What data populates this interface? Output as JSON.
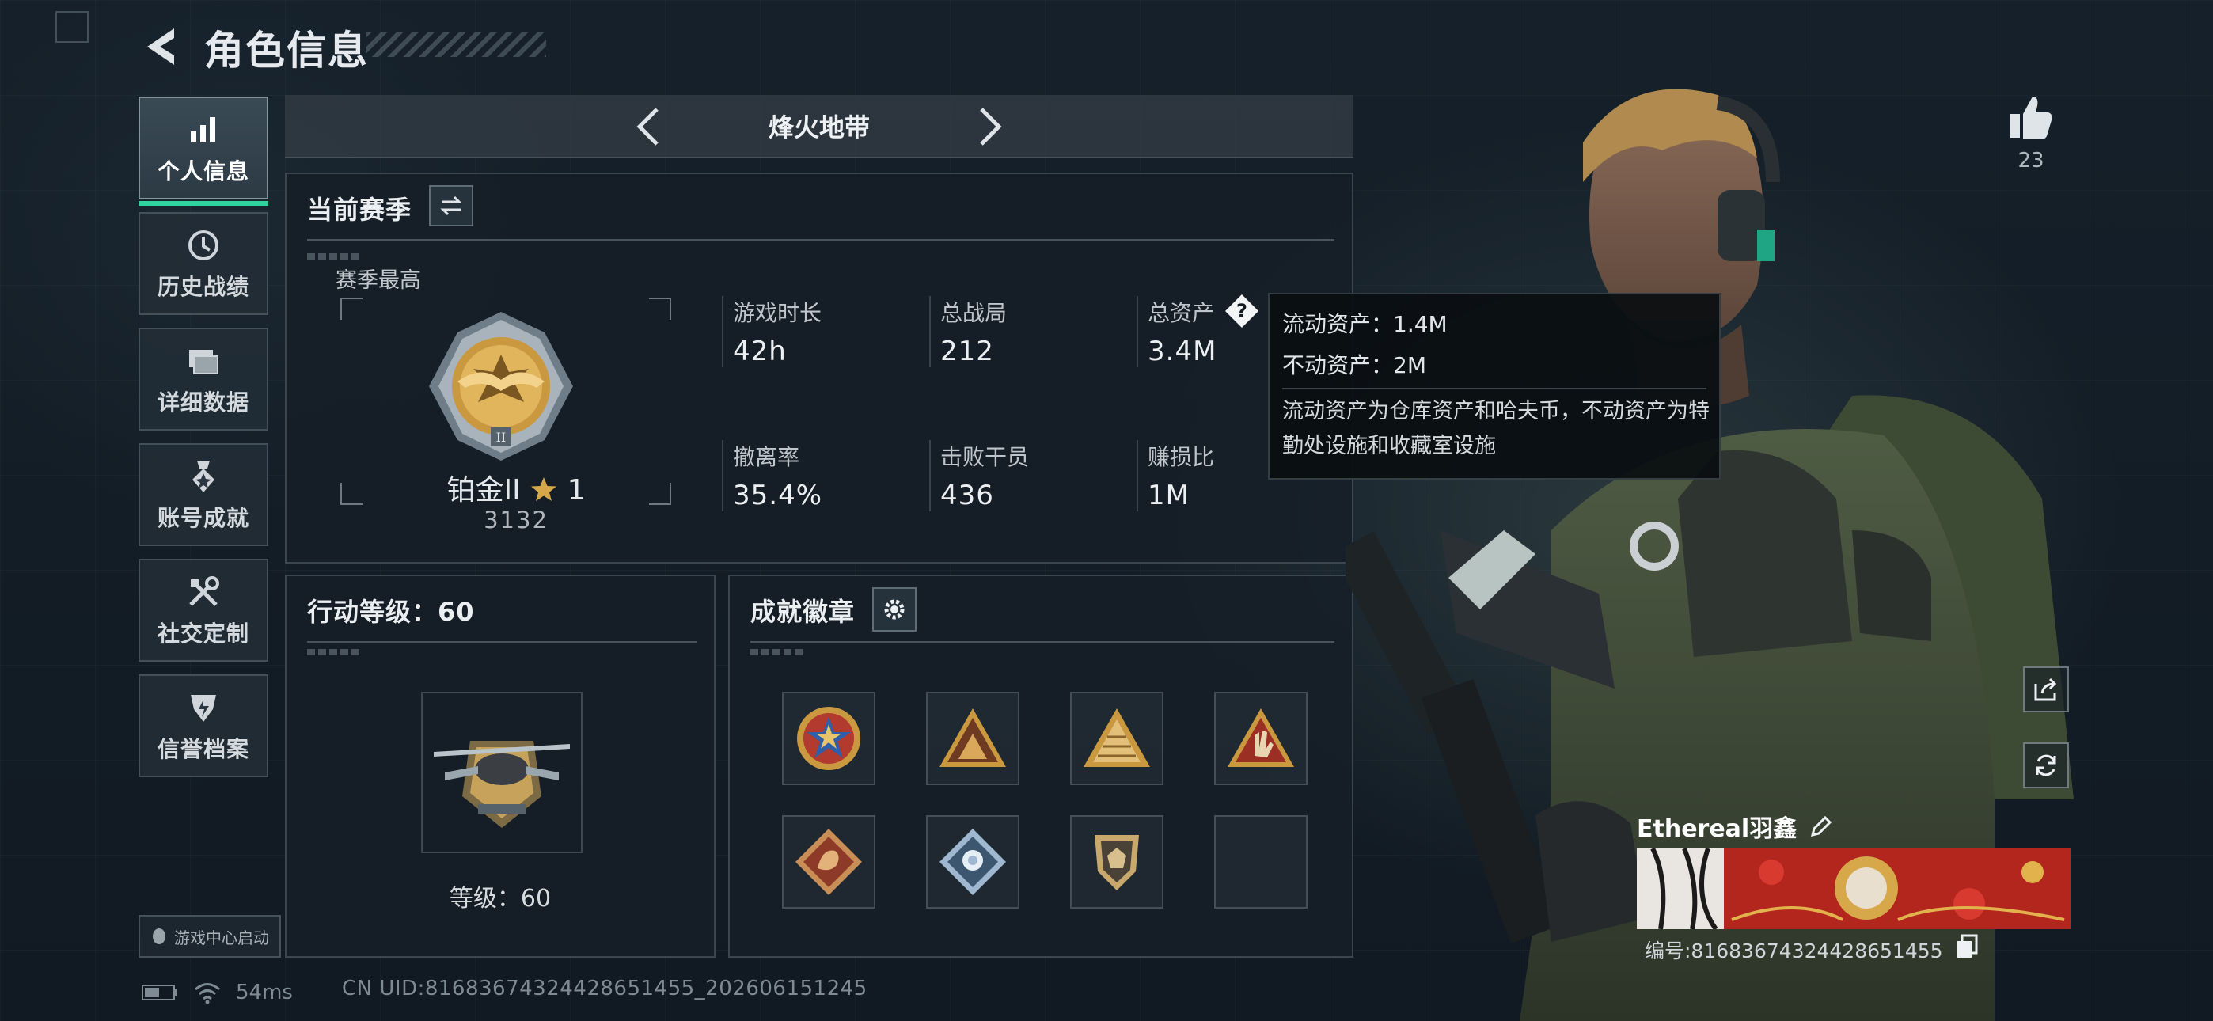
{
  "header": {
    "title": "角色信息"
  },
  "nav": {
    "items": [
      {
        "label": "个人信息",
        "icon": "bar-chart-icon",
        "active": true
      },
      {
        "label": "历史战绩",
        "icon": "history-icon"
      },
      {
        "label": "详细数据",
        "icon": "folder-icon"
      },
      {
        "label": "账号成就",
        "icon": "medal-icon"
      },
      {
        "label": "社交定制",
        "icon": "tools-icon"
      },
      {
        "label": "信誉档案",
        "icon": "shield-icon"
      }
    ],
    "launch_label": "游戏中心启动"
  },
  "mode": {
    "title": "烽火地带"
  },
  "season": {
    "title": "当前赛季",
    "subtitle": "赛季最高",
    "rank_name": "铂金II",
    "rank_stars": "1",
    "rank_score": "3132",
    "stats": [
      {
        "label": "游戏时长",
        "value": "42h"
      },
      {
        "label": "总战局",
        "value": "212"
      },
      {
        "label": "总资产",
        "value": "3.4M"
      },
      {
        "label": "撤离率",
        "value": "35.4%"
      },
      {
        "label": "击败干员",
        "value": "436"
      },
      {
        "label": "赚损比",
        "value": "1M"
      }
    ]
  },
  "tooltip": {
    "liquid": "流动资产：1.4M",
    "fixed": "不动资产：2M",
    "description": "流动资产为仓库资产和哈夫币，不动资产为特勤处设施和收藏室设施"
  },
  "level": {
    "title": "行动等级：60",
    "text": "等级：60"
  },
  "achievements": {
    "title": "成就徽章",
    "badges": [
      {
        "icon": "star-badge-icon",
        "color": "#c0392b"
      },
      {
        "icon": "mountain-badge-icon",
        "color": "#b8862f"
      },
      {
        "icon": "pyramid-badge-icon",
        "color": "#c9a24a"
      },
      {
        "icon": "hand-badge-icon",
        "color": "#b04030"
      },
      {
        "icon": "dragon-badge-icon",
        "color": "#a0452f"
      },
      {
        "icon": "flower-badge-icon",
        "color": "#8fa9c4"
      },
      {
        "icon": "shield-badge-icon",
        "color": "#b59a6a"
      },
      {
        "icon": "empty-slot",
        "color": ""
      }
    ]
  },
  "profile": {
    "likes": "23",
    "name": "Ethereal羽鑫",
    "id_text": "编号:8168367432442865​1455"
  },
  "status": {
    "ping": "54ms",
    "uid": "CN UID:81683674324428651455_202606151245"
  },
  "colors": {
    "accent": "#2fd39d",
    "gold": "#d6a84a"
  }
}
